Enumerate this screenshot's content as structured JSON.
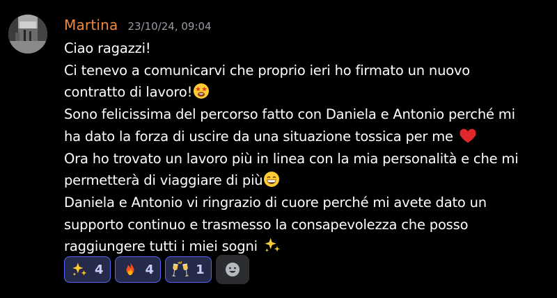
{
  "message": {
    "author": "Martina",
    "timestamp": "23/10/24, 09:04",
    "lines": [
      "Ciao ragazzi!",
      "Ci tenevo a comunicarvi che proprio ieri ho firmato un nuovo",
      "contratto di lavoro!",
      "Sono felicissima del percorso fatto con Daniela e Antonio perché mi",
      "ha dato la forza di uscire da una situazione tossica per me",
      "Ora ho trovato un lavoro più in linea con la mia personalità e che mi",
      "permetterà di viaggiare di più",
      "Daniela e Antonio vi ringrazio di cuore perché mi avete dato un",
      "supporto continuo e trasmesso la consapevolezza che posso",
      "raggiungere tutti i miei sogni"
    ],
    "inline_emojis": [
      "star-struck-emoji",
      "red-heart-emoji",
      "grinning-emoji",
      "sparkles-emoji"
    ]
  },
  "reactions": [
    {
      "emoji": "sparkles-emoji",
      "count": "4"
    },
    {
      "emoji": "fire-emoji",
      "count": "4"
    },
    {
      "emoji": "clinking-glasses-emoji",
      "count": "1"
    }
  ],
  "add_reaction_icon": "smiley-add-reaction-icon",
  "colors": {
    "background": "#000000",
    "author": "#f0893d",
    "timestamp": "#9a9ca4",
    "reaction_bg": "#262a4a",
    "reaction_border": "#5865f2",
    "reaction_text": "#c9cdfb",
    "add_reaction_bg": "#2b2d31"
  }
}
